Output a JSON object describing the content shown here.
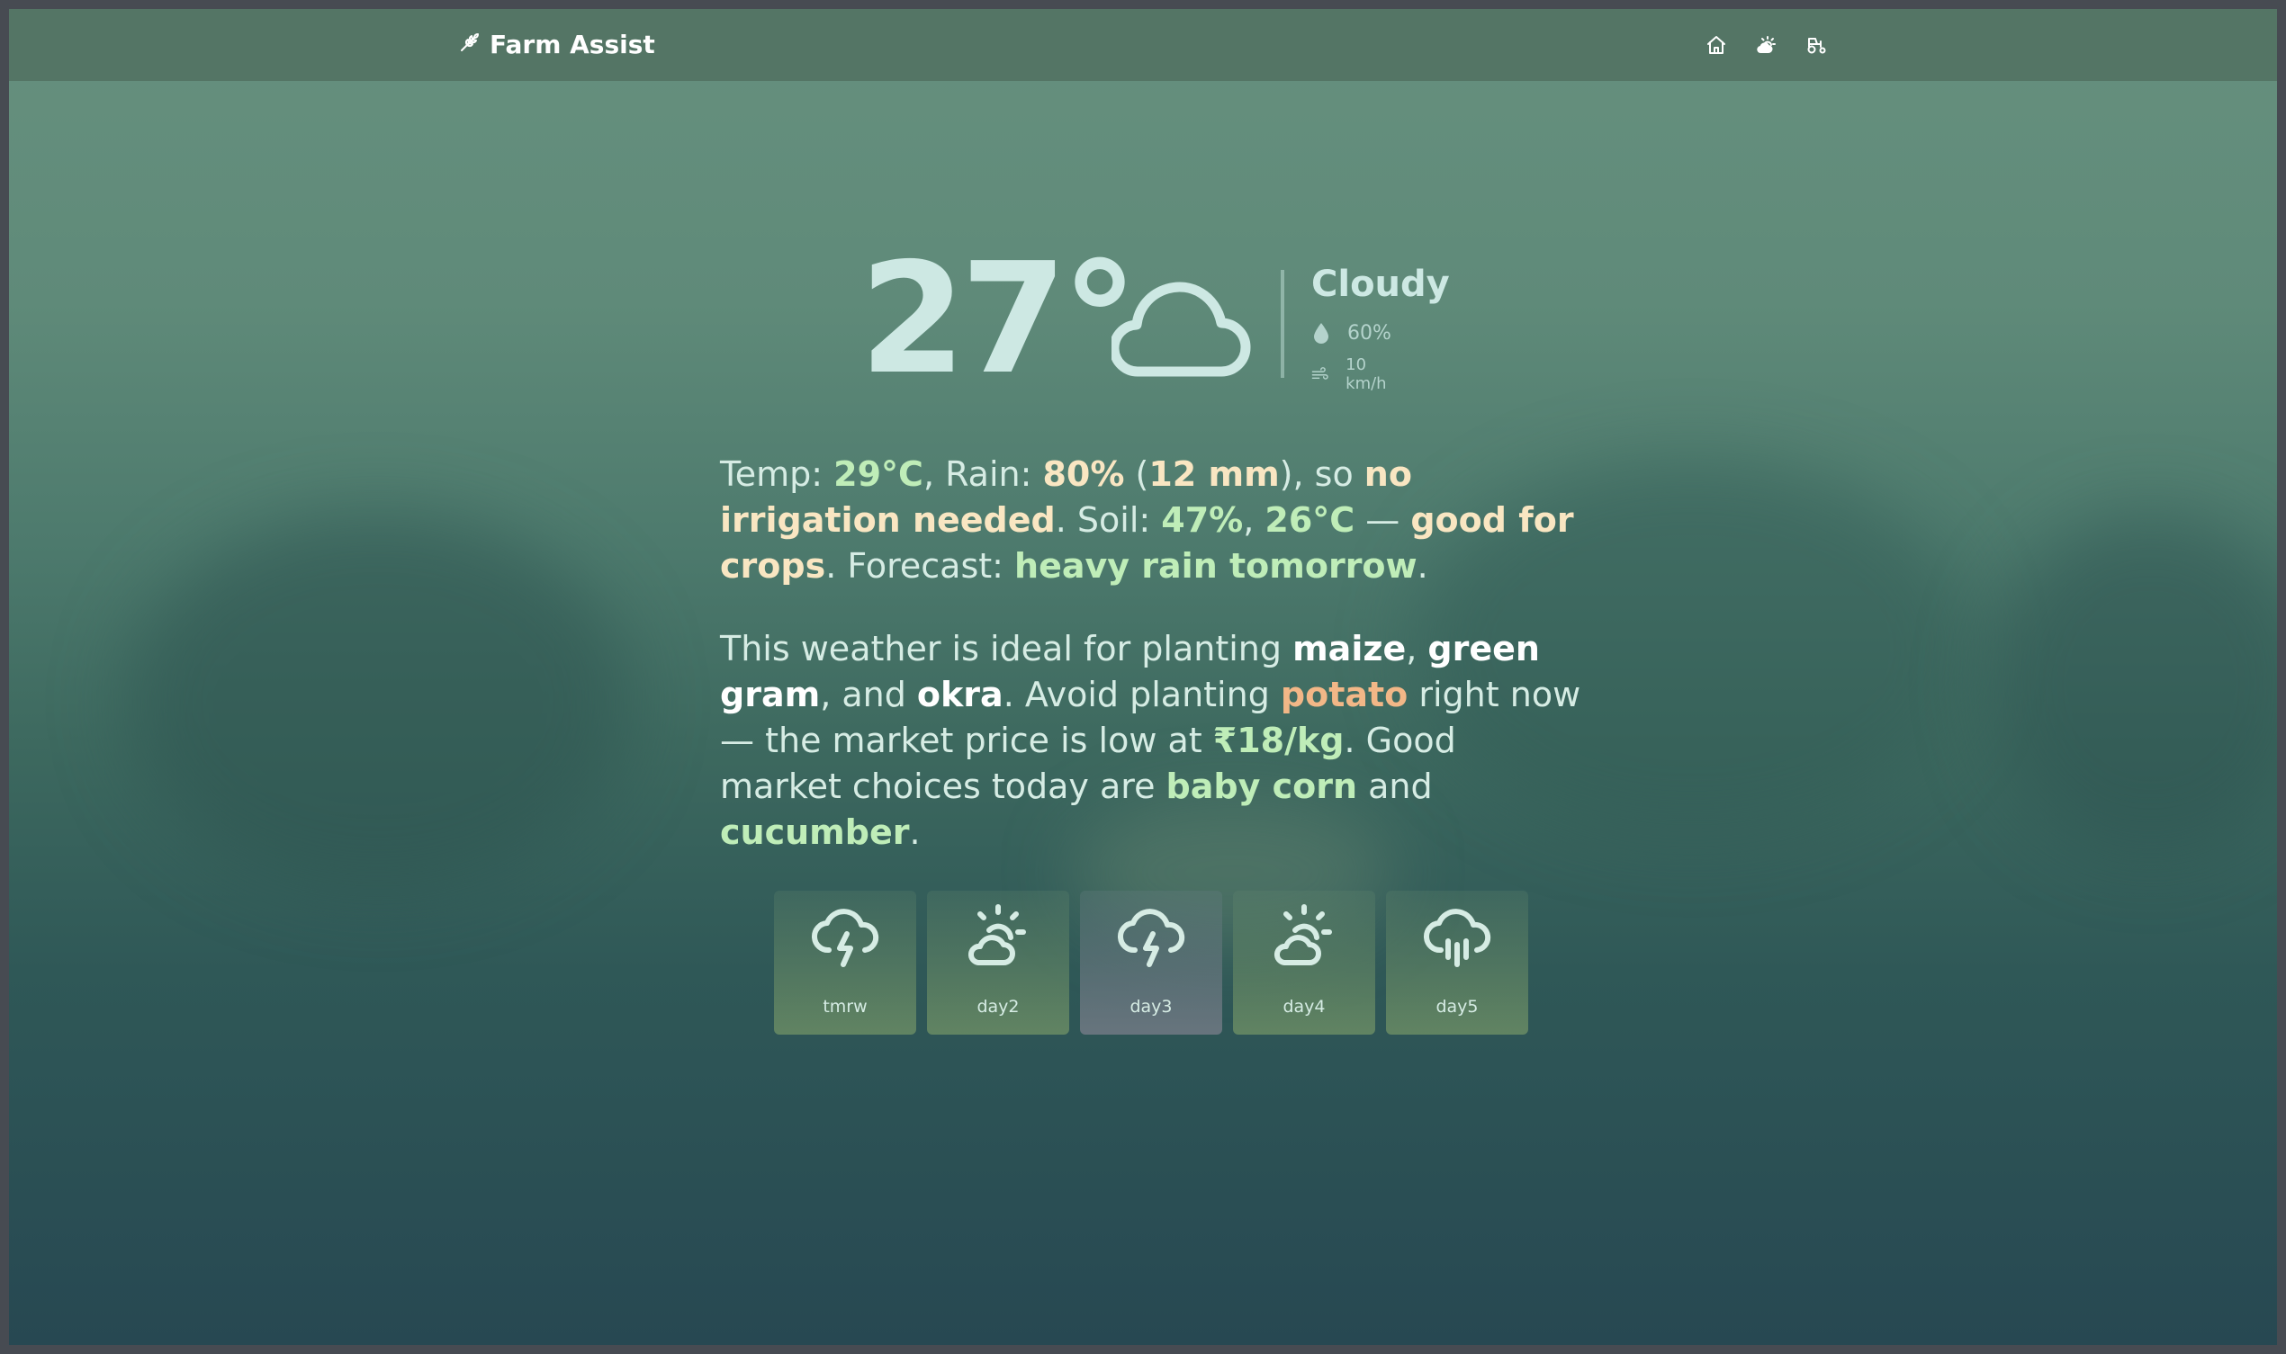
{
  "app": {
    "title": "Farm Assist"
  },
  "nav": [
    {
      "icon": "home-icon"
    },
    {
      "icon": "sun-cloud-icon"
    },
    {
      "icon": "tractor-icon"
    }
  ],
  "current": {
    "temperature": "27°",
    "condition": "Cloudy",
    "humidity": "60%",
    "wind": "10 km/h",
    "icon": "cloud-icon"
  },
  "summary": {
    "temp_label": "Temp: ",
    "temp_value": "29°C",
    "rain_label": ", Rain: ",
    "rain_value": "80%",
    "open_paren": " (",
    "rain_mm": "12 mm",
    "close_so": "), so ",
    "irrigation": "no irrigation needed",
    "soil_label": ". Soil: ",
    "soil_moisture": "47%",
    "comma": ", ",
    "soil_temp": "26°C",
    "dash": " — ",
    "soil_verdict": "good for crops",
    "forecast_label": ". Forecast: ",
    "forecast_value": "heavy rain tomorrow",
    "end": "."
  },
  "advice": {
    "t1": "This weather is ideal for planting ",
    "crop1": "maize",
    "t2": ", ",
    "crop2": "green gram",
    "t3": ", and ",
    "crop3": "okra",
    "t4": ". Avoid planting ",
    "avoid": "potato",
    "t5": " right now — the market price is low at ",
    "price": "₹18/kg",
    "t6": ". Good market choices today are ",
    "choice1": "baby corn",
    "t7": " and ",
    "choice2": "cucumber",
    "t8": "."
  },
  "forecast": [
    {
      "label": "tmrw",
      "icon": "thunderstorm-icon",
      "selected": false
    },
    {
      "label": "day2",
      "icon": "partly-sunny-icon",
      "selected": false
    },
    {
      "label": "day3",
      "icon": "thunderstorm-icon",
      "selected": true
    },
    {
      "label": "day4",
      "icon": "partly-sunny-icon",
      "selected": false
    },
    {
      "label": "day5",
      "icon": "rain-icon",
      "selected": false
    }
  ],
  "colors": {
    "accent_green": "#bfedb8",
    "accent_cream": "#f9e6c2",
    "accent_orange": "#f2b787",
    "topbar": "#547565"
  }
}
